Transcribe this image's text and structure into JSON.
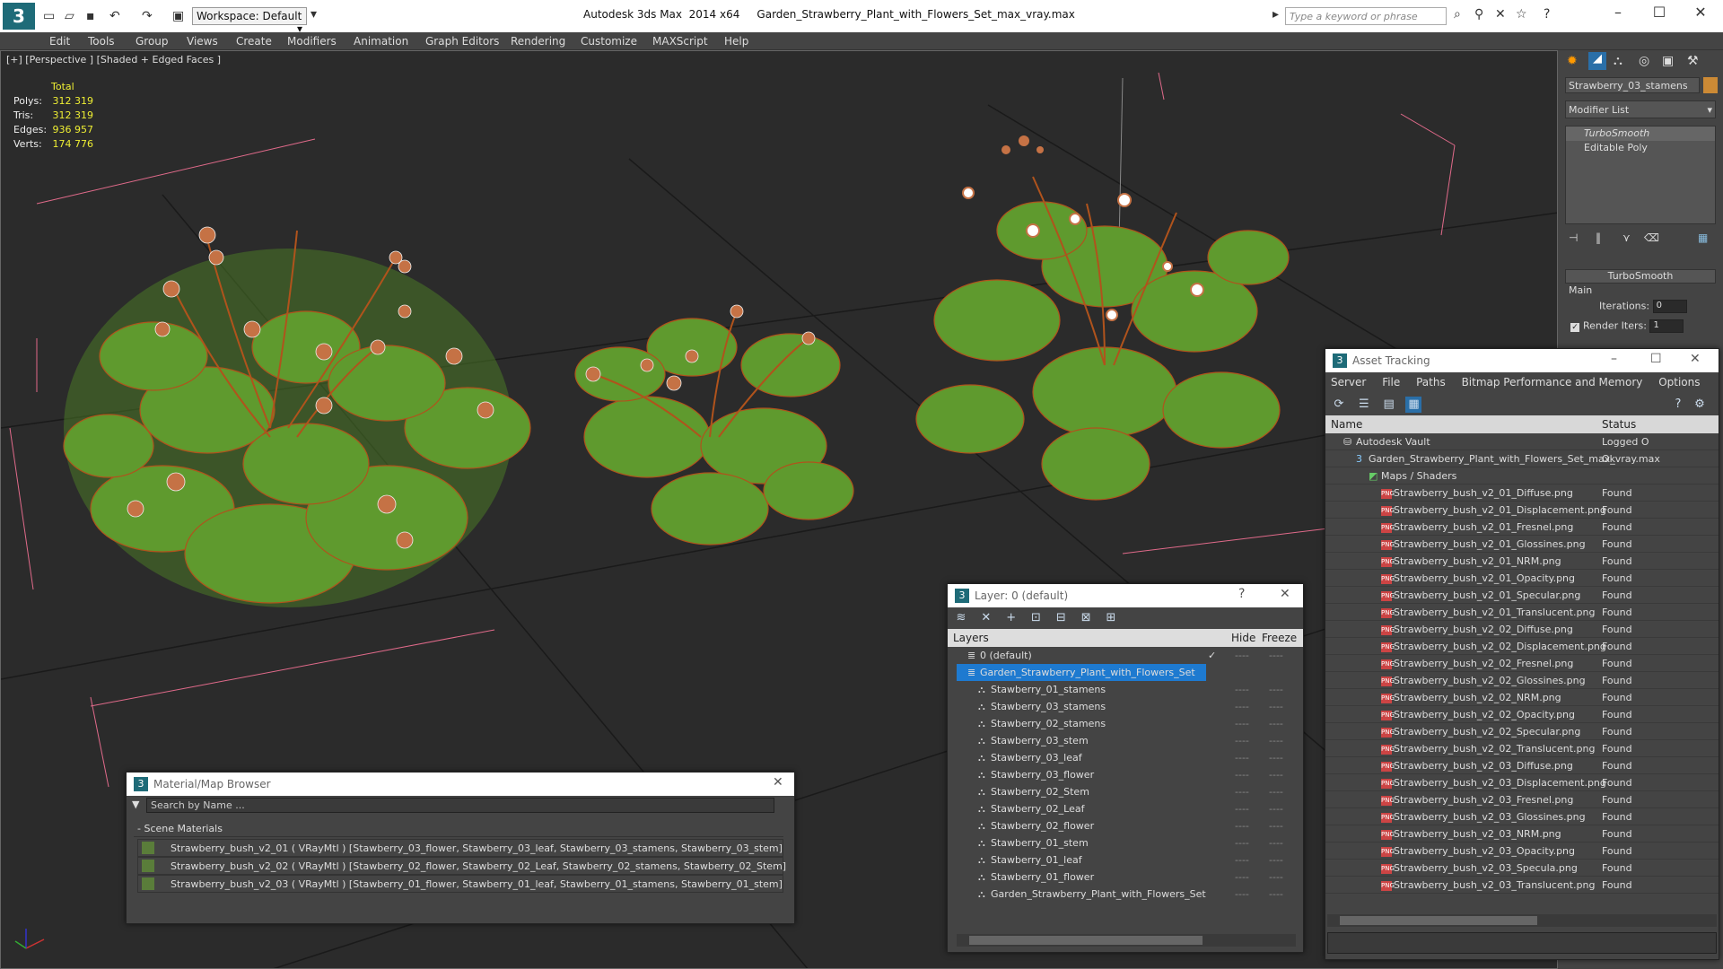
{
  "app": {
    "title": "Autodesk 3ds Max  2014 x64     Garden_Strawberry_Plant_with_Flowers_Set_max_vray.max",
    "workspace": "Workspace: Default",
    "search_placeholder": "Type a keyword or phrase"
  },
  "menu": [
    "Edit",
    "Tools",
    "Group",
    "Views",
    "Create",
    "Modifiers",
    "Animation",
    "Graph Editors",
    "Rendering",
    "Customize",
    "MAXScript",
    "Help"
  ],
  "viewport": {
    "label": "[+] [Perspective ] [Shaded + Edged Faces ]",
    "stats": {
      "header": "Total",
      "rows": [
        {
          "k": "Polys:",
          "v": "312 319"
        },
        {
          "k": "Tris:",
          "v": "312 319"
        },
        {
          "k": "Edges:",
          "v": "936 957"
        },
        {
          "k": "Verts:",
          "v": "174 776"
        }
      ]
    }
  },
  "command_panel": {
    "object_name": "Strawberry_03_stamens",
    "modifier_list": "Modifier List",
    "stack": [
      "TurboSmooth",
      "Editable Poly"
    ],
    "rollout_title": "TurboSmooth",
    "main_label": "Main",
    "iterations_label": "Iterations:",
    "iterations_value": "0",
    "render_iters_label": "Render Iters:",
    "render_iters_value": "1"
  },
  "asset_tracking": {
    "title": "Asset Tracking",
    "menu": [
      "Server",
      "File",
      "Paths",
      "Bitmap Performance and Memory",
      "Options"
    ],
    "col_name": "Name",
    "col_status": "Status",
    "vault": {
      "name": "Autodesk Vault",
      "status": "Logged O"
    },
    "file": {
      "name": "Garden_Strawberry_Plant_with_Flowers_Set_max_vray.max",
      "status": "Ok"
    },
    "group": "Maps / Shaders",
    "maps": [
      {
        "name": "Strawberry_bush_v2_01_Diffuse.png",
        "status": "Found"
      },
      {
        "name": "Strawberry_bush_v2_01_Displacement.png",
        "status": "Found"
      },
      {
        "name": "Strawberry_bush_v2_01_Fresnel.png",
        "status": "Found"
      },
      {
        "name": "Strawberry_bush_v2_01_Glossines.png",
        "status": "Found"
      },
      {
        "name": "Strawberry_bush_v2_01_NRM.png",
        "status": "Found"
      },
      {
        "name": "Strawberry_bush_v2_01_Opacity.png",
        "status": "Found"
      },
      {
        "name": "Strawberry_bush_v2_01_Specular.png",
        "status": "Found"
      },
      {
        "name": "Strawberry_bush_v2_01_Translucent.png",
        "status": "Found"
      },
      {
        "name": "Strawberry_bush_v2_02_Diffuse.png",
        "status": "Found"
      },
      {
        "name": "Strawberry_bush_v2_02_Displacement.png",
        "status": "Found"
      },
      {
        "name": "Strawberry_bush_v2_02_Fresnel.png",
        "status": "Found"
      },
      {
        "name": "Strawberry_bush_v2_02_Glossines.png",
        "status": "Found"
      },
      {
        "name": "Strawberry_bush_v2_02_NRM.png",
        "status": "Found"
      },
      {
        "name": "Strawberry_bush_v2_02_Opacity.png",
        "status": "Found"
      },
      {
        "name": "Strawberry_bush_v2_02_Specular.png",
        "status": "Found"
      },
      {
        "name": "Strawberry_bush_v2_02_Translucent.png",
        "status": "Found"
      },
      {
        "name": "Strawberry_bush_v2_03_Diffuse.png",
        "status": "Found"
      },
      {
        "name": "Strawberry_bush_v2_03_Displacement.png",
        "status": "Found"
      },
      {
        "name": "Strawberry_bush_v2_03_Fresnel.png",
        "status": "Found"
      },
      {
        "name": "Strawberry_bush_v2_03_Glossines.png",
        "status": "Found"
      },
      {
        "name": "Strawberry_bush_v2_03_NRM.png",
        "status": "Found"
      },
      {
        "name": "Strawberry_bush_v2_03_Opacity.png",
        "status": "Found"
      },
      {
        "name": "Strawberry_bush_v2_03_Specula.png",
        "status": "Found"
      },
      {
        "name": "Strawberry_bush_v2_03_Translucent.png",
        "status": "Found"
      }
    ]
  },
  "layer_panel": {
    "title": "Layer: 0 (default)",
    "col_layers": "Layers",
    "col_hide": "Hide",
    "col_freeze": "Freeze",
    "default_layer": "0 (default)",
    "set_layer": "Garden_Strawberry_Plant_with_Flowers_Set",
    "objects": [
      "Stawberry_01_stamens",
      "Stawberry_03_stamens",
      "Stawberry_02_stamens",
      "Stawberry_03_stem",
      "Stawberry_03_leaf",
      "Stawberry_03_flower",
      "Stawberry_02_Stem",
      "Stawberry_02_Leaf",
      "Stawberry_02_flower",
      "Stawberry_01_stem",
      "Stawberry_01_leaf",
      "Stawberry_01_flower",
      "Garden_Strawberry_Plant_with_Flowers_Set"
    ],
    "hide_marker": "----",
    "freeze_marker": "----"
  },
  "material_browser": {
    "title": "Material/Map Browser",
    "search_placeholder": "Search by Name ...",
    "section": "Scene Materials",
    "materials": [
      "Strawberry_bush_v2_01  ( VRayMtl )  [Stawberry_03_flower, Stawberry_03_leaf, Stawberry_03_stamens, Stawberry_03_stem]",
      "Strawberry_bush_v2_02  ( VRayMtl )  [Stawberry_02_flower, Stawberry_02_Leaf, Stawberry_02_stamens, Stawberry_02_Stem]",
      "Strawberry_bush_v2_03  ( VRayMtl )  [Stawberry_01_flower, Stawberry_01_leaf, Stawberry_01_stamens, Stawberry_01_stem]"
    ]
  },
  "colors": {
    "accent": "#1e6b78",
    "selection": "#1e7ad0",
    "leaf": "#5f9a2e",
    "wire": "#b0531c",
    "stats": "#eeee33"
  }
}
